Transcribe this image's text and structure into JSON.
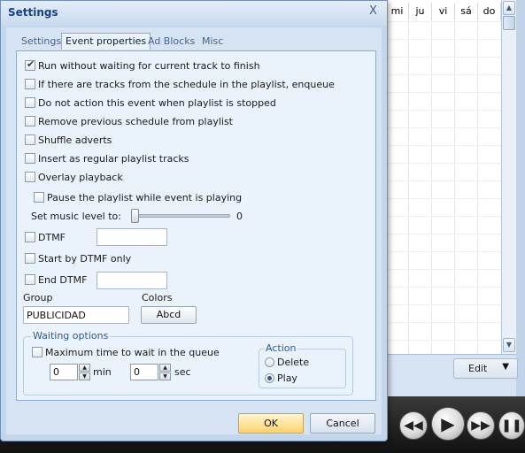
{
  "background": {
    "calendar_days": [
      "mi",
      "ju",
      "vi",
      "sá",
      "do"
    ],
    "toolbar": {
      "edit_label": "Edit"
    }
  },
  "dialog": {
    "title": "Settings",
    "close_glyph": "X",
    "tabs": [
      {
        "label": "Settings",
        "active": false
      },
      {
        "label": "Event properties",
        "active": true
      },
      {
        "label": "Ad Blocks",
        "active": false
      },
      {
        "label": "Misc",
        "active": false
      }
    ],
    "options": {
      "run_without_waiting": {
        "label": "Run without waiting for current track to finish",
        "checked": true
      },
      "enqueue_if_tracks": {
        "label": "If there are tracks from the schedule in the playlist, enqueue",
        "checked": false
      },
      "no_action_when_stopped": {
        "label": "Do not action this event when playlist is stopped",
        "checked": false
      },
      "remove_previous_schedule": {
        "label": "Remove previous schedule from playlist",
        "checked": false
      },
      "shuffle_adverts": {
        "label": "Shuffle adverts",
        "checked": false
      },
      "insert_as_regular": {
        "label": "Insert as regular playlist tracks",
        "checked": false
      },
      "overlay_playback": {
        "label": "Overlay playback",
        "checked": false
      },
      "pause_playlist": {
        "label": "Pause the playlist while event is playing",
        "checked": false
      }
    },
    "music_level": {
      "label": "Set music level to:",
      "value": "0"
    },
    "dtmf": {
      "label": "DTMF",
      "checked": false,
      "value": ""
    },
    "start_by_dtmf_only": {
      "label": "Start by DTMF only",
      "checked": false
    },
    "end_dtmf": {
      "label": "End DTMF",
      "checked": false,
      "value": ""
    },
    "group": {
      "label": "Group",
      "value": "PUBLICIDAD"
    },
    "colors": {
      "label": "Colors",
      "button_label": "Abcd"
    },
    "waiting_options": {
      "title": "Waiting options",
      "max_time": {
        "label": "Maximum time to wait in the queue",
        "checked": false
      },
      "minutes": {
        "value": "0",
        "unit": "min"
      },
      "seconds": {
        "value": "0",
        "unit": "sec"
      },
      "action": {
        "title": "Action",
        "options": [
          {
            "label": "Delete",
            "selected": false
          },
          {
            "label": "Play",
            "selected": true
          }
        ]
      }
    },
    "ok_label": "OK",
    "cancel_label": "Cancel"
  }
}
